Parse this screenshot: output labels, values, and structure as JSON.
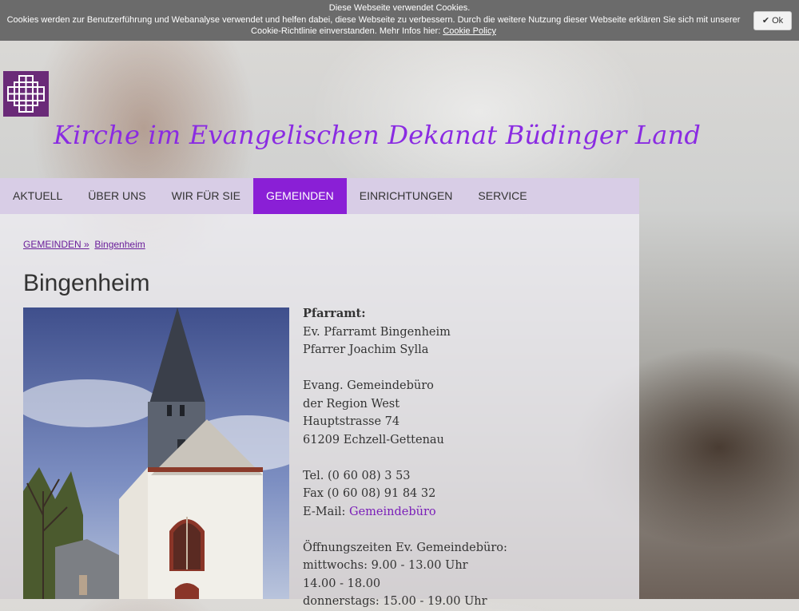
{
  "cookie": {
    "title": "Diese Webseite verwendet Cookies.",
    "text": "Cookies werden zur Benutzerführung und Webanalyse verwendet und helfen dabei, diese Webseite zu verbessern. Durch die weitere Nutzung dieser Webseite erklären Sie sich mit unserer Cookie-Richtlinie einverstanden. Mehr Infos hier: ",
    "link": "Cookie Policy",
    "ok": "Ok"
  },
  "header": {
    "title": "Kirche im Evangelischen Dekanat Büdinger Land"
  },
  "nav": [
    {
      "label": "AKTUELL"
    },
    {
      "label": "ÜBER UNS"
    },
    {
      "label": "WIR FÜR SIE"
    },
    {
      "label": "GEMEINDEN"
    },
    {
      "label": "EINRICHTUNGEN"
    },
    {
      "label": "SERVICE"
    }
  ],
  "breadcrumb": {
    "first": "GEMEINDEN »",
    "second": "Bingenheim"
  },
  "page_title": "Bingenheim",
  "info": {
    "pfarramt_label": "Pfarramt:",
    "pfarramt": "Ev. Pfarramt Bingenheim",
    "pfarrer": "Pfarrer Joachim Sylla",
    "buero1": "Evang. Gemeindebüro",
    "buero2": "der Region West",
    "street": "Hauptstrasse 74",
    "city": "61209 Echzell-Gettenau",
    "tel": "Tel. (0 60 08) 3 53",
    "fax": "Fax (0 60 08) 91 84 32",
    "email_label": "E-Mail: ",
    "email_link": "Gemeindebüro",
    "hours_title": "Öffnungszeiten Ev. Gemeindebüro:",
    "hours1": "mittwochs: 9.00 - 13.00 Uhr",
    "hours2": "14.00 - 18.00",
    "hours3": "donnerstags: 15.00 - 19.00 Uhr"
  },
  "colors": {
    "accent": "#8a1fd6",
    "nav_bg": "#d8cde6",
    "title": "#8a2be2"
  }
}
